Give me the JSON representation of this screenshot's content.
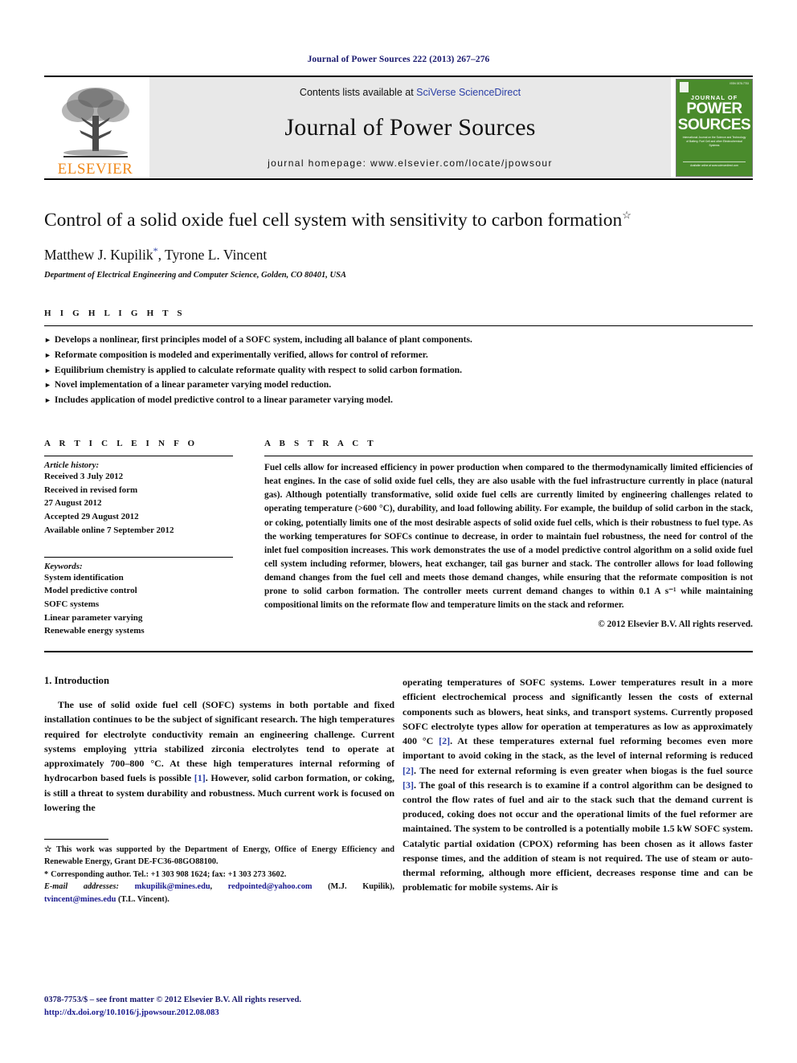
{
  "running_head": "Journal of Power Sources 222 (2013) 267–276",
  "masthead": {
    "publisher": "ELSEVIER",
    "contents_prefix": "Contents lists available at ",
    "contents_link": "SciVerse ScienceDirect",
    "journal_name": "Journal of Power Sources",
    "homepage": "journal homepage: www.elsevier.com/locate/jpowsour",
    "cover": {
      "issn": "ISSN 0378-7753",
      "journal_of": "JOURNAL OF",
      "power": "POWER",
      "sources": "SOURCES",
      "subtitle": "International Journal on the Science and Technology of Battery, Fuel Cell and other Electrochemical Systems",
      "bottom": "Available online at www.sciencedirect.com"
    }
  },
  "article": {
    "title": "Control of a solid oxide fuel cell system with sensitivity to carbon formation",
    "title_footnote_marker": "☆",
    "authors": "Matthew J. Kupilik",
    "author_marker": "*",
    "authors_rest": ", Tyrone L. Vincent",
    "affiliation": "Department of Electrical Engineering and Computer Science, Golden, CO 80401, USA"
  },
  "highlights": {
    "label": "H I G H L I G H T S",
    "items": [
      "Develops a nonlinear, first principles model of a SOFC system, including all balance of plant components.",
      "Reformate composition is modeled and experimentally verified, allows for control of reformer.",
      "Equilibrium chemistry is applied to calculate reformate quality with respect to solid carbon formation.",
      "Novel implementation of a linear parameter varying model reduction.",
      "Includes application of model predictive control to a linear parameter varying model."
    ]
  },
  "article_info": {
    "label": "A R T I C L E  I N F O",
    "history_label": "Article history:",
    "history": [
      "Received 3 July 2012",
      "Received in revised form",
      "27 August 2012",
      "Accepted 29 August 2012",
      "Available online 7 September 2012"
    ],
    "keywords_label": "Keywords:",
    "keywords": [
      "System identification",
      "Model predictive control",
      "SOFC systems",
      "Linear parameter varying",
      "Renewable energy systems"
    ]
  },
  "abstract": {
    "label": "A B S T R A C T",
    "text": "Fuel cells allow for increased efficiency in power production when compared to the thermodynamically limited efficiencies of heat engines. In the case of solid oxide fuel cells, they are also usable with the fuel infrastructure currently in place (natural gas). Although potentially transformative, solid oxide fuel cells are currently limited by engineering challenges related to operating temperature (>600 °C), durability, and load following ability. For example, the buildup of solid carbon in the stack, or coking, potentially limits one of the most desirable aspects of solid oxide fuel cells, which is their robustness to fuel type. As the working temperatures for SOFCs continue to decrease, in order to maintain fuel robustness, the need for control of the inlet fuel composition increases. This work demonstrates the use of a model predictive control algorithm on a solid oxide fuel cell system including reformer, blowers, heat exchanger, tail gas burner and stack. The controller allows for load following demand changes from the fuel cell and meets those demand changes, while ensuring that the reformate composition is not prone to solid carbon formation. The controller meets current demand changes to within 0.1 A s⁻¹ while maintaining compositional limits on the reformate flow and temperature limits on the stack and reformer.",
    "copyright": "© 2012 Elsevier B.V. All rights reserved."
  },
  "introduction": {
    "heading": "1.  Introduction",
    "left_paragraph_a": "The use of solid oxide fuel cell (SOFC) systems in both portable and fixed installation continues to be the subject of significant research. The high temperatures required for electrolyte conductivity remain an engineering challenge. Current systems employing yttria stabilized zirconia electrolytes tend to operate at approximately 700–800 °C. At these high temperatures internal reforming of hydrocarbon based fuels is possible ",
    "left_ref_1": "[1]",
    "left_paragraph_b": ". However, solid carbon formation, or coking, is still a threat to system durability and robustness. Much current work is focused on lowering the",
    "right_a": "operating temperatures of SOFC systems. Lower temperatures result in a more efficient electrochemical process and significantly lessen the costs of external components such as blowers, heat sinks, and transport systems. Currently proposed SOFC electrolyte types allow for operation at temperatures as low as approximately 400 °C ",
    "right_ref_2a": "[2]",
    "right_b": ". At these temperatures external fuel reforming becomes even more important to avoid coking in the stack, as the level of internal reforming is reduced ",
    "right_ref_2b": "[2]",
    "right_c": ". The need for external reforming is even greater when biogas is the fuel source ",
    "right_ref_3": "[3]",
    "right_d": ". The goal of this research is to examine if a control algorithm can be designed to control the flow rates of fuel and air to the stack such that the demand current is produced, coking does not occur and the operational limits of the fuel reformer are maintained. The system to be controlled is a potentially mobile 1.5 kW SOFC system. Catalytic partial oxidation (CPOX) reforming has been chosen as it allows faster response times, and the addition of steam is not required. The use of steam or auto-thermal reforming, although more efficient, decreases response time and can be problematic for mobile systems. Air is"
  },
  "footnotes": {
    "star_marker": "☆",
    "star_text": "This work was supported by the Department of Energy, Office of Energy Efficiency and Renewable Energy, Grant DE-FC36-08GO88100.",
    "corr_marker": "*",
    "corr_text": "Corresponding author. Tel.: +1 303 908 1624; fax: +1 303 273 3602.",
    "email_label": "E-mail addresses:",
    "email_1": "mkupilik@mines.edu",
    "email_2": "redpointed@yahoo.com",
    "email_1_owner": "(M.J. Kupilik)",
    "email_3": "tvincent@mines.edu",
    "email_3_owner": "(T.L. Vincent)."
  },
  "bottom": {
    "issn_line": "0378-7753/$ – see front matter © 2012 Elsevier B.V. All rights reserved.",
    "doi_line": "http://dx.doi.org/10.1016/j.jpowsour.2012.08.083"
  },
  "colors": {
    "link_blue": "#2b3fa6",
    "header_navy": "#1a1a6e",
    "elsevier_orange": "#f08a1c",
    "cover_green": "#4a8b2c",
    "masthead_gray": "#e8e8e8"
  }
}
